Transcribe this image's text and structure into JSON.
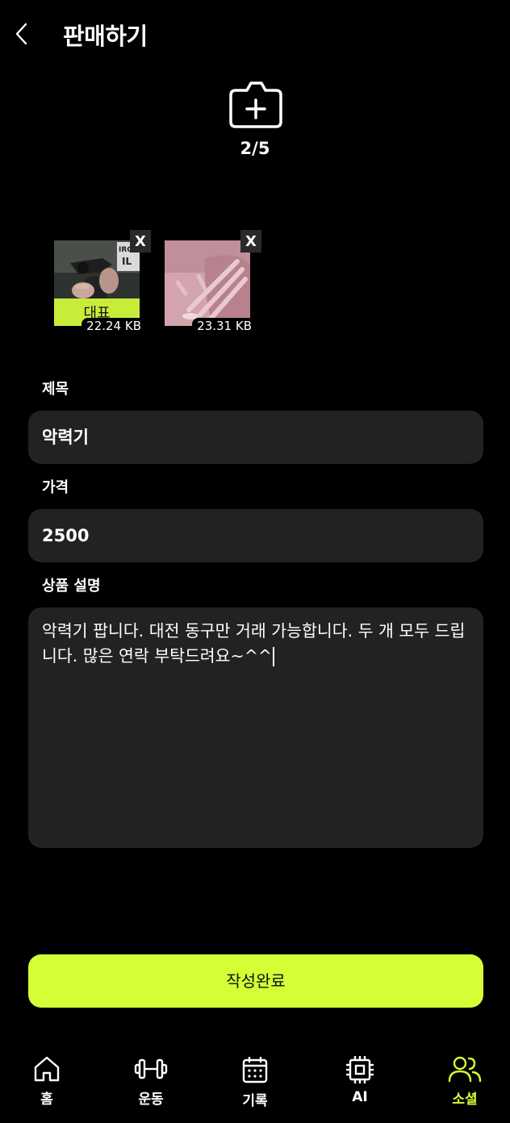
{
  "header": {
    "title": "판매하기",
    "back_icon": "chevron-left-icon"
  },
  "photo": {
    "icon": "camera-add-icon",
    "count_label": "2/5"
  },
  "images": [
    {
      "size": "22.24 KB",
      "badge": "대표",
      "remove_label": "X"
    },
    {
      "size": "23.31 KB",
      "remove_label": "X"
    }
  ],
  "form": {
    "title_label": "제목",
    "title_value": "악력기",
    "price_label": "가격",
    "price_value": "2500",
    "desc_label": "상품 설명",
    "desc_value": "악력기 팝니다. 대전 동구만 거래 가능합니다. 두 개 모두 드립니다. 많은 연락 부탁드려요~^^"
  },
  "submit_label": "작성완료",
  "tabs": [
    {
      "label": "홈",
      "icon": "home-icon"
    },
    {
      "label": "운동",
      "icon": "dumbbell-icon"
    },
    {
      "label": "기록",
      "icon": "calendar-icon"
    },
    {
      "label": "AI",
      "icon": "chip-icon"
    },
    {
      "label": "소셜",
      "icon": "users-icon",
      "active": true
    }
  ],
  "colors": {
    "accent": "#d4ff36",
    "field_bg": "#222222",
    "background": "#000000"
  }
}
